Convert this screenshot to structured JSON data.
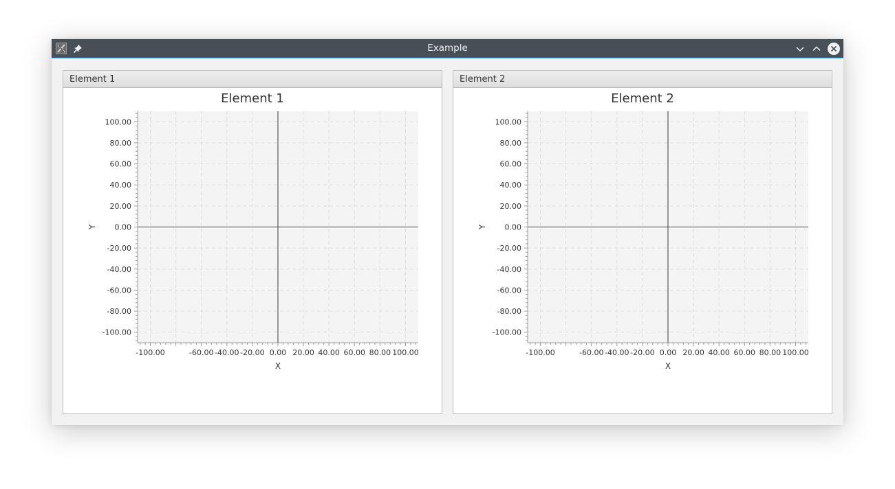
{
  "window": {
    "title": "Example",
    "titlebar_color": "#475057",
    "accent_color": "#3daee9",
    "app_icon": "x-app-icon",
    "pin_icon": "pin-icon",
    "buttons": [
      "minimize",
      "maximize",
      "close"
    ]
  },
  "panels": [
    {
      "header": "Element 1"
    },
    {
      "header": "Element 2"
    }
  ],
  "chart_data": [
    {
      "type": "scatter",
      "title": "Element 1",
      "xlabel": "X",
      "ylabel": "Y",
      "xlim": [
        -110,
        110
      ],
      "ylim": [
        -110,
        110
      ],
      "x_ticks": [
        "-100.00",
        "-60.00",
        "-40.00",
        "-20.00",
        "0.00",
        "20.00",
        "40.00",
        "60.00",
        "80.00",
        "100.00"
      ],
      "y_ticks": [
        "100.00",
        "80.00",
        "60.00",
        "40.00",
        "20.00",
        "0.00",
        "-20.00",
        "-40.00",
        "-60.00",
        "-80.00",
        "-100.00"
      ],
      "grid": true,
      "series": []
    },
    {
      "type": "scatter",
      "title": "Element 2",
      "xlabel": "X",
      "ylabel": "Y",
      "xlim": [
        -110,
        110
      ],
      "ylim": [
        -110,
        110
      ],
      "x_ticks": [
        "-100.00",
        "-60.00",
        "-40.00",
        "-20.00",
        "0.00",
        "20.00",
        "40.00",
        "60.00",
        "80.00",
        "100.00"
      ],
      "y_ticks": [
        "100.00",
        "80.00",
        "60.00",
        "40.00",
        "20.00",
        "0.00",
        "-20.00",
        "-40.00",
        "-60.00",
        "-80.00",
        "-100.00"
      ],
      "grid": true,
      "series": []
    }
  ]
}
